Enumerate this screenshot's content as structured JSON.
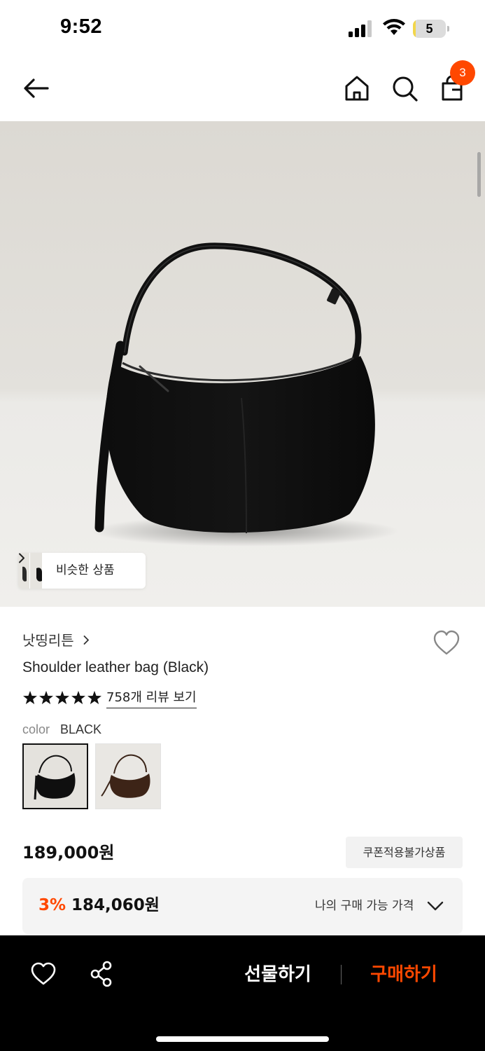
{
  "status_bar": {
    "time": "9:52",
    "battery_level": "5",
    "battery_fraction": 0.05,
    "icons": [
      "signal-icon",
      "wifi-icon",
      "battery-icon"
    ]
  },
  "header": {
    "icons": [
      "back-arrow-icon",
      "home-icon",
      "search-icon",
      "shopping-bag-icon"
    ],
    "cart_count": "3"
  },
  "gallery": {
    "similar_products_label": "비슷한 상품"
  },
  "product": {
    "brand": "낫띵리튼",
    "title": "Shoulder leather bag (Black)",
    "rating_stars": 5,
    "review_link": "758개 리뷰 보기",
    "color_label": "color",
    "color_value": "BLACK",
    "colors": [
      "black",
      "brown"
    ],
    "price": "189,000원",
    "coupon_badge": "쿠폰적용불가상품",
    "discount_rate": "3%",
    "discount_price": "184,060원",
    "my_price_label": "나의 구매 가능 가격"
  },
  "bottom_bar": {
    "gift_label": "선물하기",
    "buy_label": "구매하기"
  },
  "colors": {
    "accent": "#ff4800",
    "bottom_bar_bg": "#000000"
  }
}
